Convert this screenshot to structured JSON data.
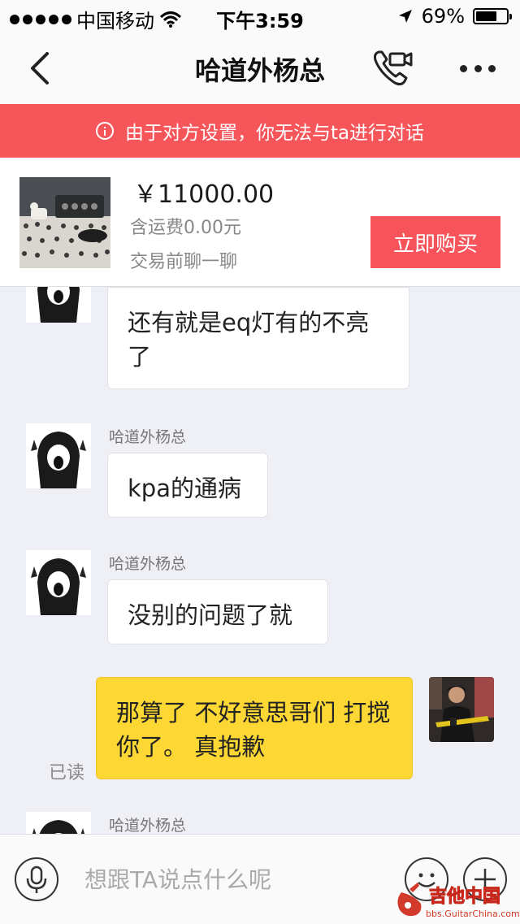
{
  "status_bar": {
    "carrier": "中国移动",
    "time": "下午3:59",
    "battery": "69%",
    "battery_level": 0.69
  },
  "nav": {
    "title": "哈道外杨总",
    "back_icon": "chevron-left-icon",
    "call_icon": "phone-video-icon",
    "more_icon": "more-dots-icon"
  },
  "notice": {
    "text": "由于对方设置，你无法与ta进行对话",
    "color": "#f6565a"
  },
  "product": {
    "price": "￥11000.00",
    "shipping": "含运费0.00元",
    "chat_hint": "交易前聊一聊",
    "buy_label": "立即购买",
    "accent": "#f6545a"
  },
  "messages": [
    {
      "from": "other",
      "sender": "",
      "text": "还有就是eq灯有的不亮了"
    },
    {
      "from": "other",
      "sender": "哈道外杨总",
      "text": "kpa的通病"
    },
    {
      "from": "other",
      "sender": "哈道外杨总",
      "text": "没别的问题了就"
    },
    {
      "from": "me",
      "text": "那算了 不好意思哥们 打搅你了。 真抱歉",
      "status": "已读"
    },
    {
      "from": "other",
      "sender": "哈道外杨总",
      "text": ""
    }
  ],
  "input": {
    "placeholder": "想跟TA说点什么呢",
    "voice_icon": "microphone-icon",
    "emoji_icon": "emoji-icon",
    "plus_icon": "plus-icon"
  },
  "watermark": {
    "text": "吉他中国",
    "subtext": "bbs.GuitarChina.com"
  }
}
